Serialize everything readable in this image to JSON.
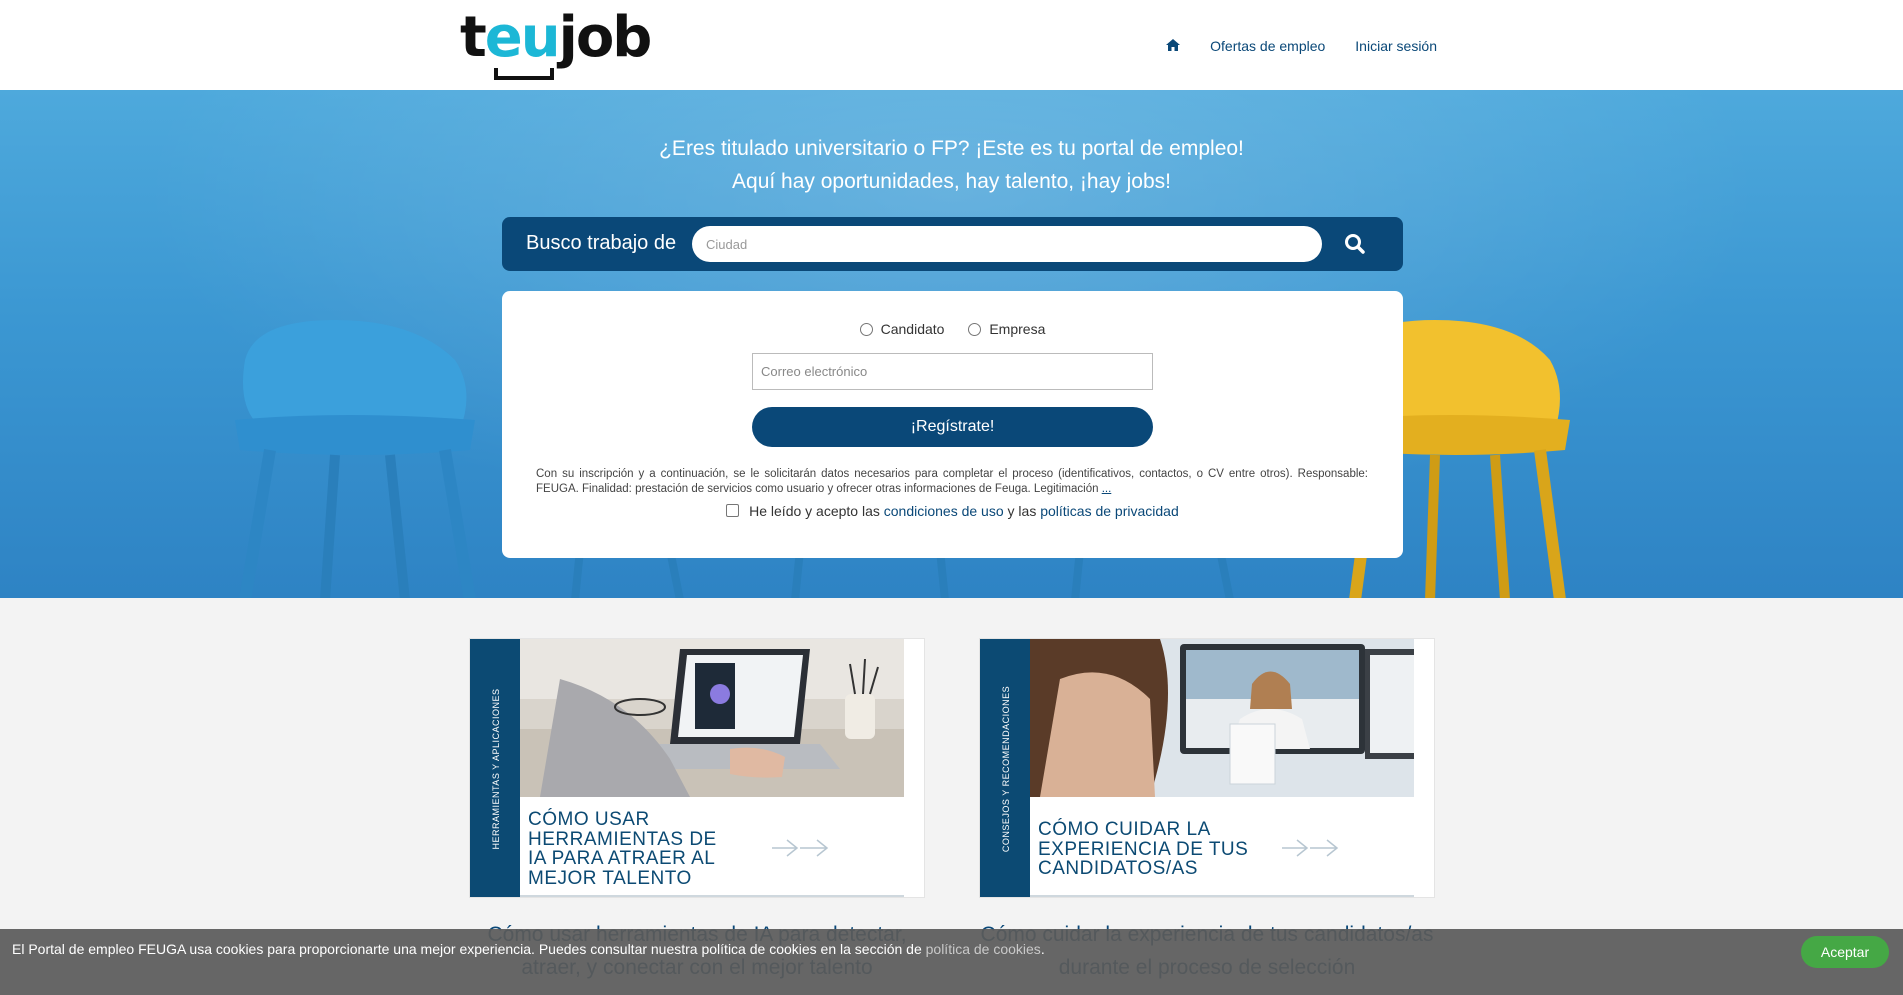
{
  "brand": {
    "logo_t": "t",
    "logo_eu": "eu",
    "logo_job": "job"
  },
  "nav": {
    "home_icon": "home-icon",
    "jobs_label": "Ofertas de empleo",
    "login_label": "Iniciar sesión"
  },
  "hero": {
    "line1": "¿Eres titulado universitario o FP? ¡Este es tu portal de empleo!",
    "line2": "Aquí hay oportunidades, hay talento, ¡hay jobs!"
  },
  "search": {
    "label": "Busco trabajo de",
    "placeholder": "Ciudad",
    "button_icon": "search-icon"
  },
  "register": {
    "radio_candidate": "Candidato",
    "radio_company": "Empresa",
    "email_placeholder": "Correo electrónico",
    "button_label": "¡Regístrate!",
    "legal_text": "Con su inscripción y a continuación, se le solicitarán datos necesarios para completar el proceso (identificativos, contactos, o CV entre otros). Responsable: FEUGA. Finalidad: prestación de servicios como usuario y ofrecer otras informaciones de Feuga. Legitimación",
    "legal_more": "...",
    "accept_prefix": "He leído y acepto las",
    "terms_link": "condiciones de uso",
    "accept_middle": "y las",
    "privacy_link": "políticas de privacidad"
  },
  "cards": [
    {
      "category": "HERRAMIENTAS Y APLICACIONES",
      "caption": [
        "CÓMO USAR",
        "HERRAMIENTAS DE",
        "IA PARA ATRAER AL",
        "MEJOR TALENTO"
      ],
      "title": "Cómo usar herramientas de IA para detectar, atraer, y conectar con el mejor talento"
    },
    {
      "category": "CONSEJOS Y RECOMENDACIONES",
      "caption": [
        "CÓMO CUIDAR LA",
        "EXPERIENCIA DE TUS",
        "CANDIDATOS/AS"
      ],
      "title": "Cómo cuidar la experiencia de tus candidatos/as durante el proceso de selección"
    }
  ],
  "cookie": {
    "text": "El Portal de empleo FEUGA usa cookies para proporcionarte una mejor experiencia. Puedes consultar nuestra política de cookies en la sección de",
    "link": "política de cookies",
    "end": ".",
    "button": "Aceptar"
  },
  "colors": {
    "primary": "#0a4878",
    "accent": "#1cb7d6",
    "accept_green": "#45a845"
  }
}
